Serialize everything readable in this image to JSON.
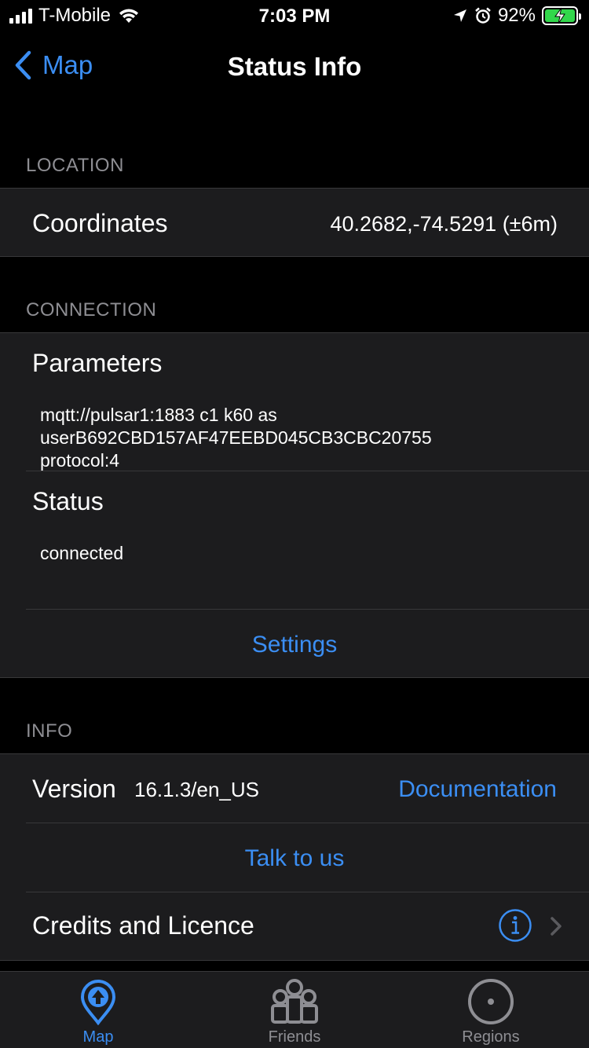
{
  "status_bar": {
    "carrier": "T-Mobile",
    "time": "7:03 PM",
    "battery": "92%"
  },
  "nav": {
    "back_label": "Map",
    "title": "Status Info"
  },
  "location": {
    "header": "LOCATION",
    "coordinates_label": "Coordinates",
    "coordinates_value": "40.2682,-74.5291 (±6m)"
  },
  "connection": {
    "header": "CONNECTION",
    "parameters_label": "Parameters",
    "parameters_line1": "mqtt://pulsar1:1883 c1 k60 as",
    "parameters_line2": "userB692CBD157AF47EEBD045CB3CBC20755",
    "parameters_line3": "protocol:4",
    "status_label": "Status",
    "status_value": "connected",
    "settings_link": "Settings"
  },
  "info": {
    "header": "INFO",
    "version_label": "Version",
    "version_value": "16.1.3/en_US",
    "documentation_link": "Documentation",
    "talk_link": "Talk to us",
    "credits_label": "Credits and Licence"
  },
  "tabbar": {
    "tabs": [
      {
        "label": "Map",
        "icon": "map-pin-icon",
        "active": true
      },
      {
        "label": "Friends",
        "icon": "friends-icon",
        "active": false
      },
      {
        "label": "Regions",
        "icon": "regions-icon",
        "active": false
      }
    ]
  },
  "colors": {
    "accent": "#3b8ef3",
    "background": "#000000",
    "cell": "#1c1c1e",
    "secondary_text": "#8e8e93",
    "battery": "#32d74b"
  }
}
